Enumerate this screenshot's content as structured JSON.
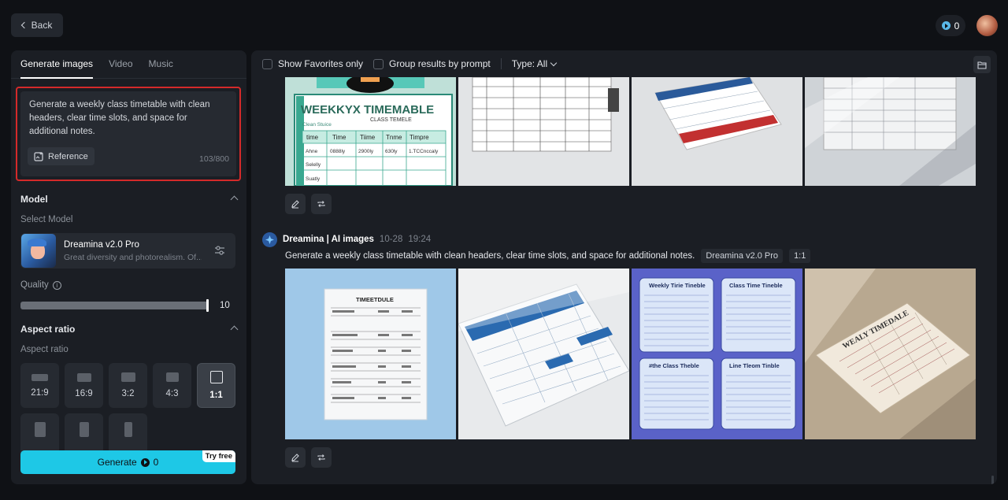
{
  "header": {
    "back_label": "Back",
    "credits": "0"
  },
  "tabs": [
    {
      "label": "Generate images",
      "active": true
    },
    {
      "label": "Video",
      "active": false
    },
    {
      "label": "Music",
      "active": false
    }
  ],
  "prompt": {
    "text": "Generate a weekly class timetable with clean headers, clear time slots, and space for additional notes.",
    "reference_label": "Reference",
    "char_count": "103/800"
  },
  "model": {
    "section_title": "Model",
    "select_label": "Select Model",
    "name": "Dreamina v2.0 Pro",
    "description": "Great diversity and photorealism. Of..."
  },
  "quality": {
    "label": "Quality",
    "value": "10",
    "level": 1.0
  },
  "aspect": {
    "section_title": "Aspect ratio",
    "label": "Aspect ratio",
    "options": [
      "21:9",
      "16:9",
      "3:2",
      "4:3",
      "1:1"
    ],
    "selected": "1:1"
  },
  "generate": {
    "label": "Generate",
    "cost": "0",
    "badge": "Try free"
  },
  "toolbar": {
    "favorites_label": "Show Favorites only",
    "group_label": "Group results by prompt",
    "type_label": "Type: All"
  },
  "result1": {
    "image_texts": {
      "a_title": "WEEKKYX TIMEMABLE",
      "a_subtitle": "CLASS TEMELE",
      "a_note": "Clean Stuice",
      "a_headers": [
        "time",
        "Time",
        "Tiime",
        "Tnme",
        "Timpre"
      ],
      "a_row": [
        "Ahne",
        "0888ly",
        "2900ly",
        "630ly",
        "1.TCCnccaly"
      ],
      "a_rows": [
        "Selelly",
        "Suatly"
      ]
    }
  },
  "result2": {
    "source": "Dreamina | AI images",
    "date": "10-28",
    "time": "19:24",
    "prompt": "Generate a weekly class timetable with clean headers, clear time slots, and space for additional notes.",
    "model_pill": "Dreamina v2.0 Pro",
    "ratio_pill": "1:1",
    "image_texts": {
      "a_title": "TIMEETDULE",
      "c_titles": [
        "Weekly Tirie Tineble",
        "Class  Time Tineble",
        "#the  Class Theble",
        "Line  Tleom Tinble"
      ],
      "d_title": "WEALY TIMEDALE"
    }
  },
  "colors": {
    "accent": "#1ec8e6",
    "highlight_border": "#d42a2a",
    "panel": "#1b1e24",
    "bg": "#0f1115"
  }
}
